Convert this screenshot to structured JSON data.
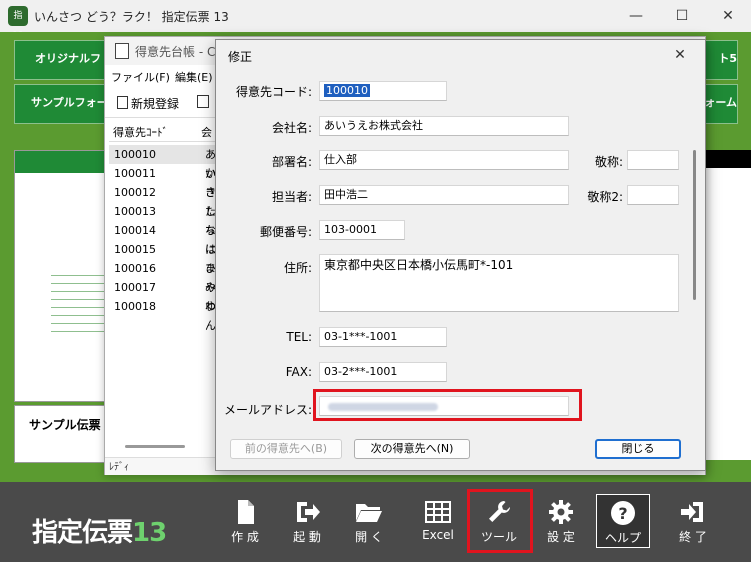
{
  "app": {
    "icon_text": "指13",
    "title": "いんさつ どう？ラク！ 指定伝票 13",
    "minimize_glyph": "—",
    "maximize_glyph": "☐",
    "close_glyph": "✕"
  },
  "background_buttons": {
    "original_form": "オリジナルフォー",
    "sample_form": "サンプルフォー",
    "right_top": "ト5",
    "right_mid": "ォーム",
    "sample_slip": "サンプル伝票"
  },
  "ledger": {
    "title": "得意先台帳 - C",
    "menu": [
      "ファイル(F)",
      "編集(E)"
    ],
    "new_button": "新規登録",
    "columns": [
      "得意先ｺｰﾄﾞ",
      "会"
    ],
    "rows": [
      {
        "code": "100010",
        "name": "あい"
      },
      {
        "code": "100011",
        "name": "かき"
      },
      {
        "code": "100012",
        "name": "さし"
      },
      {
        "code": "100013",
        "name": "たち"
      },
      {
        "code": "100014",
        "name": "なに"
      },
      {
        "code": "100015",
        "name": "はひ"
      },
      {
        "code": "100016",
        "name": "まみ"
      },
      {
        "code": "100017",
        "name": "やゆ"
      },
      {
        "code": "100018",
        "name": "わん"
      }
    ],
    "status": "ﾚﾃﾞｨ"
  },
  "dialog": {
    "title": "修正",
    "close_glyph": "✕",
    "labels": {
      "code": "得意先コード:",
      "company": "会社名:",
      "department": "部署名:",
      "title1": "敬称:",
      "person": "担当者:",
      "title2": "敬称2:",
      "zip": "郵便番号:",
      "address": "住所:",
      "tel": "TEL:",
      "fax": "FAX:",
      "email": "メールアドレス:"
    },
    "values": {
      "code": "100010",
      "company": "あいうえお株式会社",
      "department": "仕入部",
      "title1": "",
      "person": "田中浩二",
      "title2": "",
      "zip": "103-0001",
      "address": "東京都中央区日本橋小伝馬町*-101",
      "tel": "03-1***-1001",
      "fax": "03-2***-1001",
      "email": ""
    },
    "buttons": {
      "prev": "前の得意先へ(B)",
      "next": "次の得意先へ(N)",
      "close": "閉じる"
    }
  },
  "toolbar": {
    "brand_text": "指定伝票",
    "brand_num": "13",
    "items": [
      {
        "label": "作 成",
        "icon": "document-icon"
      },
      {
        "label": "起 動",
        "icon": "launch-icon"
      },
      {
        "label": "開 く",
        "icon": "folder-icon"
      },
      {
        "label": "Excel",
        "icon": "grid-icon"
      },
      {
        "label": "ツール",
        "icon": "wrench-icon"
      },
      {
        "label": "設 定",
        "icon": "gear-icon"
      },
      {
        "label": "ヘルプ",
        "icon": "help-icon"
      },
      {
        "label": "終 了",
        "icon": "exit-icon"
      }
    ]
  },
  "highlight_color": "#e0141e"
}
